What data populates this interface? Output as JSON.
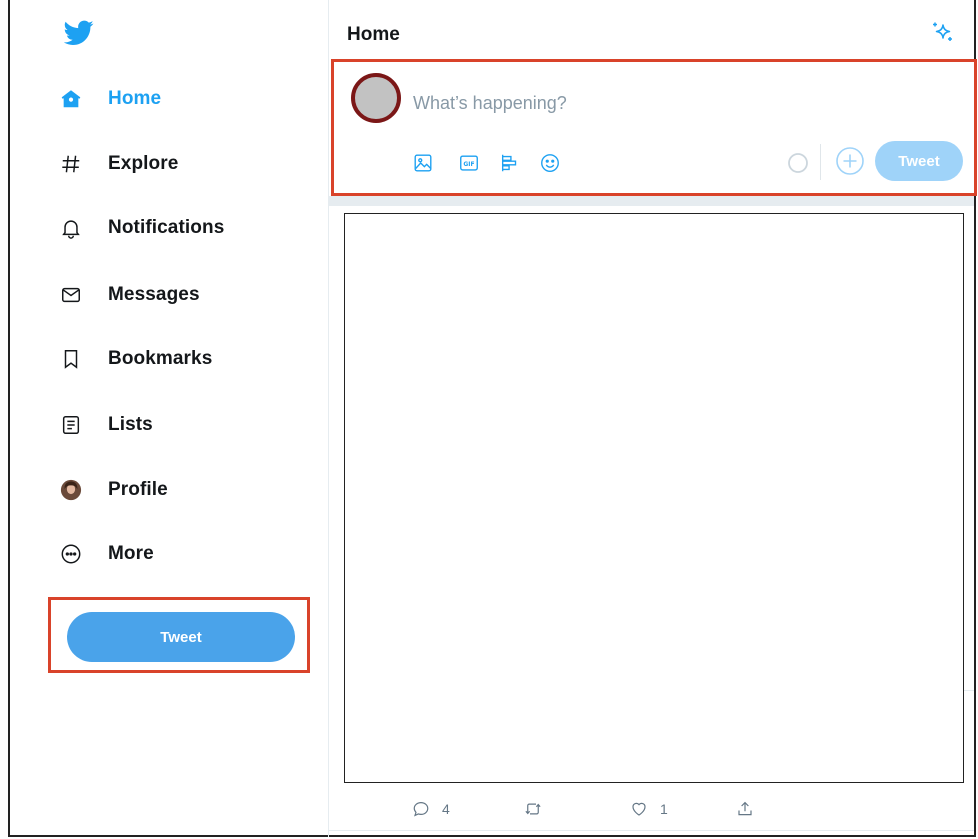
{
  "sidebar": {
    "logo_icon": "twitter-bird-icon",
    "items": [
      {
        "label": "Home",
        "icon": "home-icon",
        "active": true
      },
      {
        "label": "Explore",
        "icon": "hashtag-icon"
      },
      {
        "label": "Notifications",
        "icon": "bell-icon"
      },
      {
        "label": "Messages",
        "icon": "envelope-icon"
      },
      {
        "label": "Bookmarks",
        "icon": "bookmark-icon"
      },
      {
        "label": "Lists",
        "icon": "list-icon"
      },
      {
        "label": "Profile",
        "icon": "profile-avatar-icon"
      },
      {
        "label": "More",
        "icon": "more-icon"
      }
    ],
    "tweet_button": "Tweet"
  },
  "header": {
    "title": "Home",
    "sparkle_icon": "top-tweets-sparkle-icon"
  },
  "compose": {
    "placeholder": "What’s happening?",
    "tools": [
      "image-icon",
      "gif-icon",
      "poll-icon",
      "emoji-icon"
    ],
    "tweet_button": "Tweet"
  },
  "tweet": {
    "replies": "4",
    "retweets": "",
    "likes": "1"
  },
  "colors": {
    "accent": "#1da1f2",
    "highlight_border": "#d9432a",
    "tweet_button": "#4aa3ea",
    "tweet_button_disabled": "#9fd3f9"
  }
}
